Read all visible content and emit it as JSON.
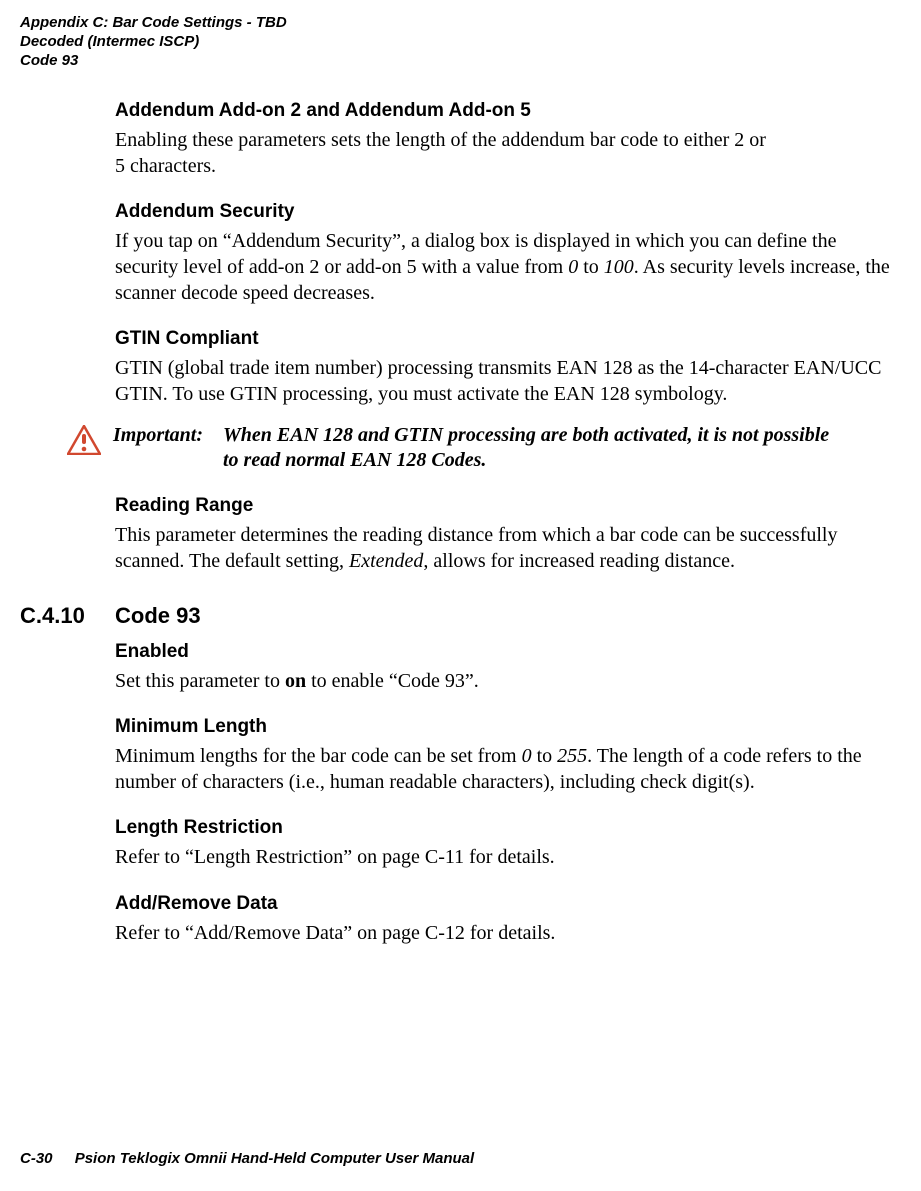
{
  "running_head": {
    "l1": "Appendix C: Bar Code Settings - TBD",
    "l2": "Decoded (Intermec ISCP)",
    "l3": "Code 93"
  },
  "s1": {
    "title": "Addendum Add-on 2 and Addendum Add-on 5",
    "p1a": "Enabling these parameters sets the length of the addendum bar code to either 2 or",
    "p1b": "5 characters."
  },
  "s2": {
    "title": "Addendum Security",
    "p_a": "If you tap on “Addendum Security”, a dialog box is displayed in which you can define the security level of add-on 2 or add-on 5 with a value from ",
    "i1": "0",
    "mid": " to ",
    "i2": "100",
    "p_b": ". As security levels increase, the scanner decode speed decreases."
  },
  "s3": {
    "title": "GTIN Compliant",
    "p": "GTIN (global trade item number) processing transmits EAN 128 as the 14-character EAN/UCC GTIN. To use GTIN processing, you must activate the EAN 128 symbology."
  },
  "important": {
    "label": "Important:",
    "text": "When EAN 128 and GTIN processing are both activated, it is not possible to read normal EAN 128 Codes."
  },
  "s4": {
    "title": "Reading Range",
    "p_a": "This parameter determines the reading distance from which a bar code can be successfully scanned. The default setting, ",
    "i1": "Extended",
    "p_b": ", allows for increased reading distance."
  },
  "section": {
    "num": "C.4.10",
    "title": "Code 93"
  },
  "s5": {
    "title": "Enabled",
    "p_a": "Set this parameter to ",
    "b1": "on",
    "p_b": " to enable “Code 93”."
  },
  "s6": {
    "title": "Minimum Length",
    "p_a": "Minimum lengths for the bar code can be set from ",
    "i1": "0",
    "mid": " to ",
    "i2": "255",
    "p_b": ". The length of a code refers to the number of characters (i.e., human readable characters), including check digit(s)."
  },
  "s7": {
    "title": "Length Restriction",
    "p": "Refer to “Length Restriction” on page C-11 for details."
  },
  "s8": {
    "title": "Add/Remove Data",
    "p": "Refer to “Add/Remove Data” on page C-12 for details."
  },
  "footer": {
    "page": "C-30",
    "title": "Psion Teklogix Omnii Hand-Held Computer User Manual"
  }
}
